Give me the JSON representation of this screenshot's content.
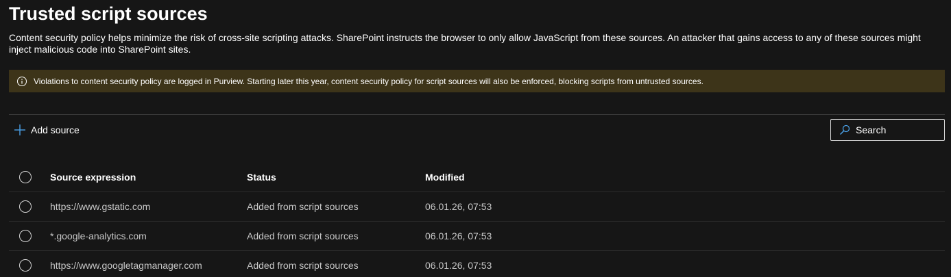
{
  "page": {
    "title": "Trusted script sources",
    "description": "Content security policy helps minimize the risk of cross-site scripting attacks. SharePoint instructs the browser to only allow JavaScript from these sources. An attacker that gains access to any of these sources might inject malicious code into SharePoint sites."
  },
  "banner": {
    "icon": "info-icon",
    "text": "Violations to content security policy are logged in Purview. Starting later this year, content security policy for script sources will also be enforced, blocking scripts from untrusted sources.",
    "background_color": "#3d3419"
  },
  "toolbar": {
    "add_icon": "plus-icon",
    "add_label": "Add source",
    "search_icon": "search-icon",
    "search_placeholder": "Search",
    "accent_color": "#4aa0e6"
  },
  "table": {
    "columns": [
      "Source expression",
      "Status",
      "Modified"
    ],
    "rows": [
      {
        "source": "https://www.gstatic.com",
        "status": "Added from script sources",
        "modified": "06.01.26, 07:53"
      },
      {
        "source": "*.google-analytics.com",
        "status": "Added from script sources",
        "modified": "06.01.26, 07:53"
      },
      {
        "source": "https://www.googletagmanager.com",
        "status": "Added from script sources",
        "modified": "06.01.26, 07:53"
      }
    ]
  }
}
